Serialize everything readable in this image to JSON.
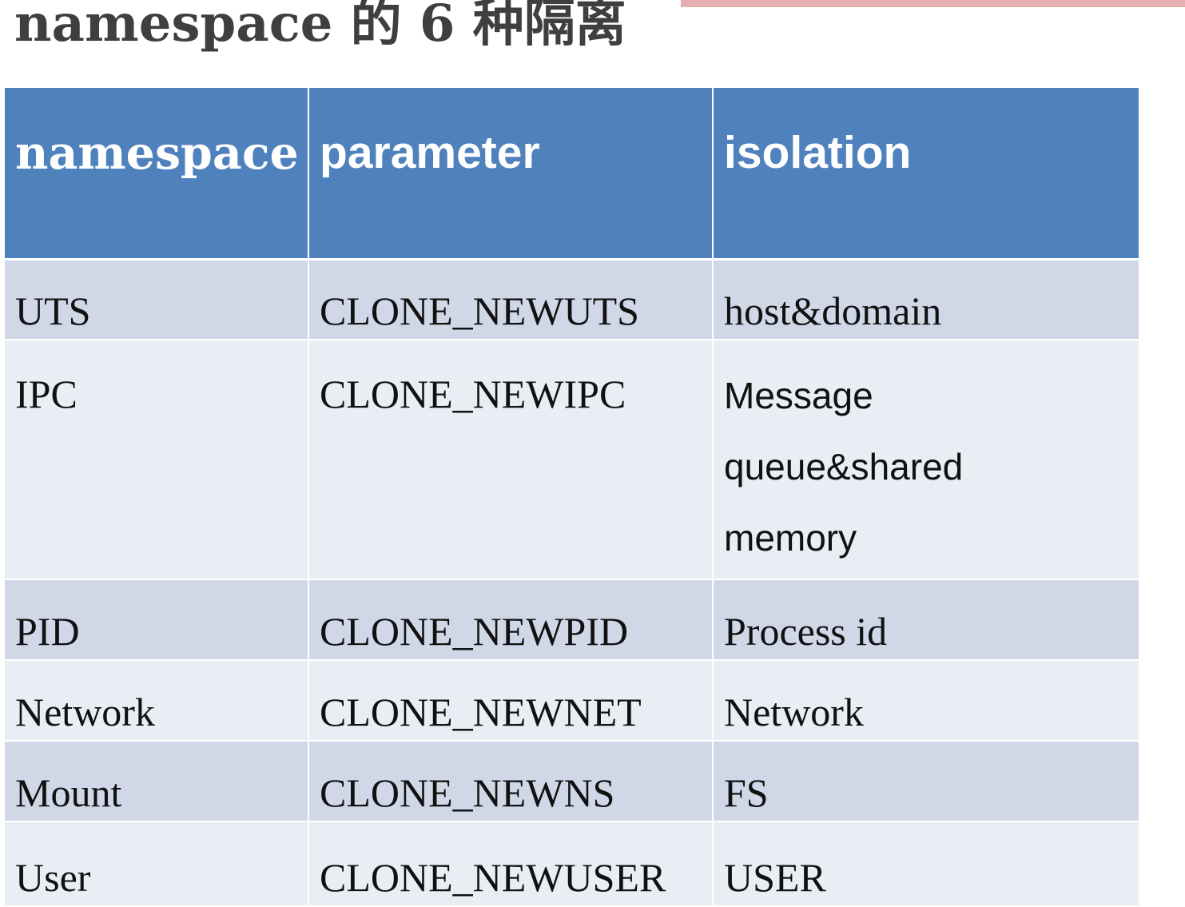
{
  "title": "namespace 的 6 种隔离",
  "colors": {
    "header_bg": "#4f81bd",
    "row_odd_bg": "#d0d8e8",
    "row_even_bg": "#e9edf4",
    "accent_bar": "#e6aeb0",
    "title_text": "#3f3f3f"
  },
  "table": {
    "headers": [
      "namespace",
      "parameter",
      "isolation"
    ],
    "rows": [
      {
        "namespace": "UTS",
        "parameter": "CLONE_NEWUTS",
        "isolation": "host&domain"
      },
      {
        "namespace": "IPC",
        "parameter": "CLONE_NEWIPC",
        "isolation_lines": [
          "Message",
          "queue&shared",
          "memory"
        ]
      },
      {
        "namespace": "PID",
        "parameter": "CLONE_NEWPID",
        "isolation": "Process id"
      },
      {
        "namespace": "Network",
        "parameter": "CLONE_NEWNET",
        "isolation": "Network"
      },
      {
        "namespace": "Mount",
        "parameter": "CLONE_NEWNS",
        "isolation": "FS"
      },
      {
        "namespace": "User",
        "parameter": "CLONE_NEWUSER",
        "isolation": "USER"
      }
    ]
  }
}
